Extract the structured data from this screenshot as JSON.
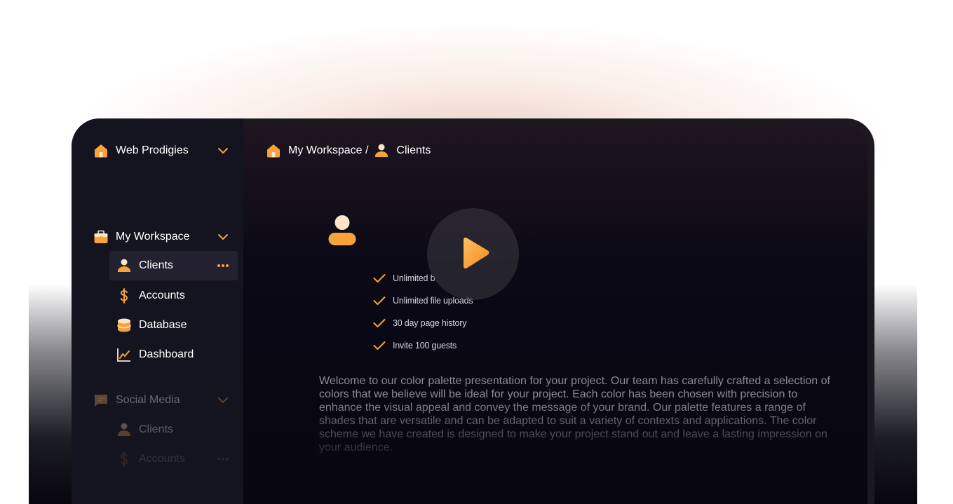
{
  "sidebar": {
    "workspace_switcher": {
      "label": "Web Prodigies"
    },
    "sections": [
      {
        "label": "My Workspace",
        "items": [
          {
            "label": "Clients"
          },
          {
            "label": "Accounts"
          },
          {
            "label": "Database"
          },
          {
            "label": "Dashboard"
          }
        ]
      },
      {
        "label": "Social Media",
        "items": [
          {
            "label": "Clients"
          },
          {
            "label": "Accounts"
          }
        ]
      }
    ]
  },
  "breadcrumb": {
    "parent": "My Workspace /",
    "current": "Clients"
  },
  "features": [
    "Unlimited b",
    "Unlimited file uploads",
    "30 day page history",
    "Invite 100 guests"
  ],
  "description": "Welcome to our color palette presentation for your project. Our team has carefully crafted a selection of colors that we believe will be ideal for your project. Each color has been chosen with precision to enhance the visual appeal and convey the message of your brand. Our palette features a range of shades that are versatile and can be adapted to suit a variety of contexts and applications. The color scheme we have created is designed to make your project stand out and leave a lasting impression on your audience.",
  "colors": {
    "accent": "#f7a23b",
    "sidebar_bg": "#141320",
    "main_bg": "#07060f",
    "selected_bg": "#23212f"
  },
  "icons": {
    "home": "home-icon",
    "briefcase": "briefcase-icon",
    "user": "user-icon",
    "dollar": "dollar-icon",
    "database": "database-icon",
    "chart": "chart-icon",
    "message": "message-icon",
    "chevron": "chevron-down-icon",
    "more": "more-icon",
    "check": "check-icon",
    "play": "play-icon"
  }
}
